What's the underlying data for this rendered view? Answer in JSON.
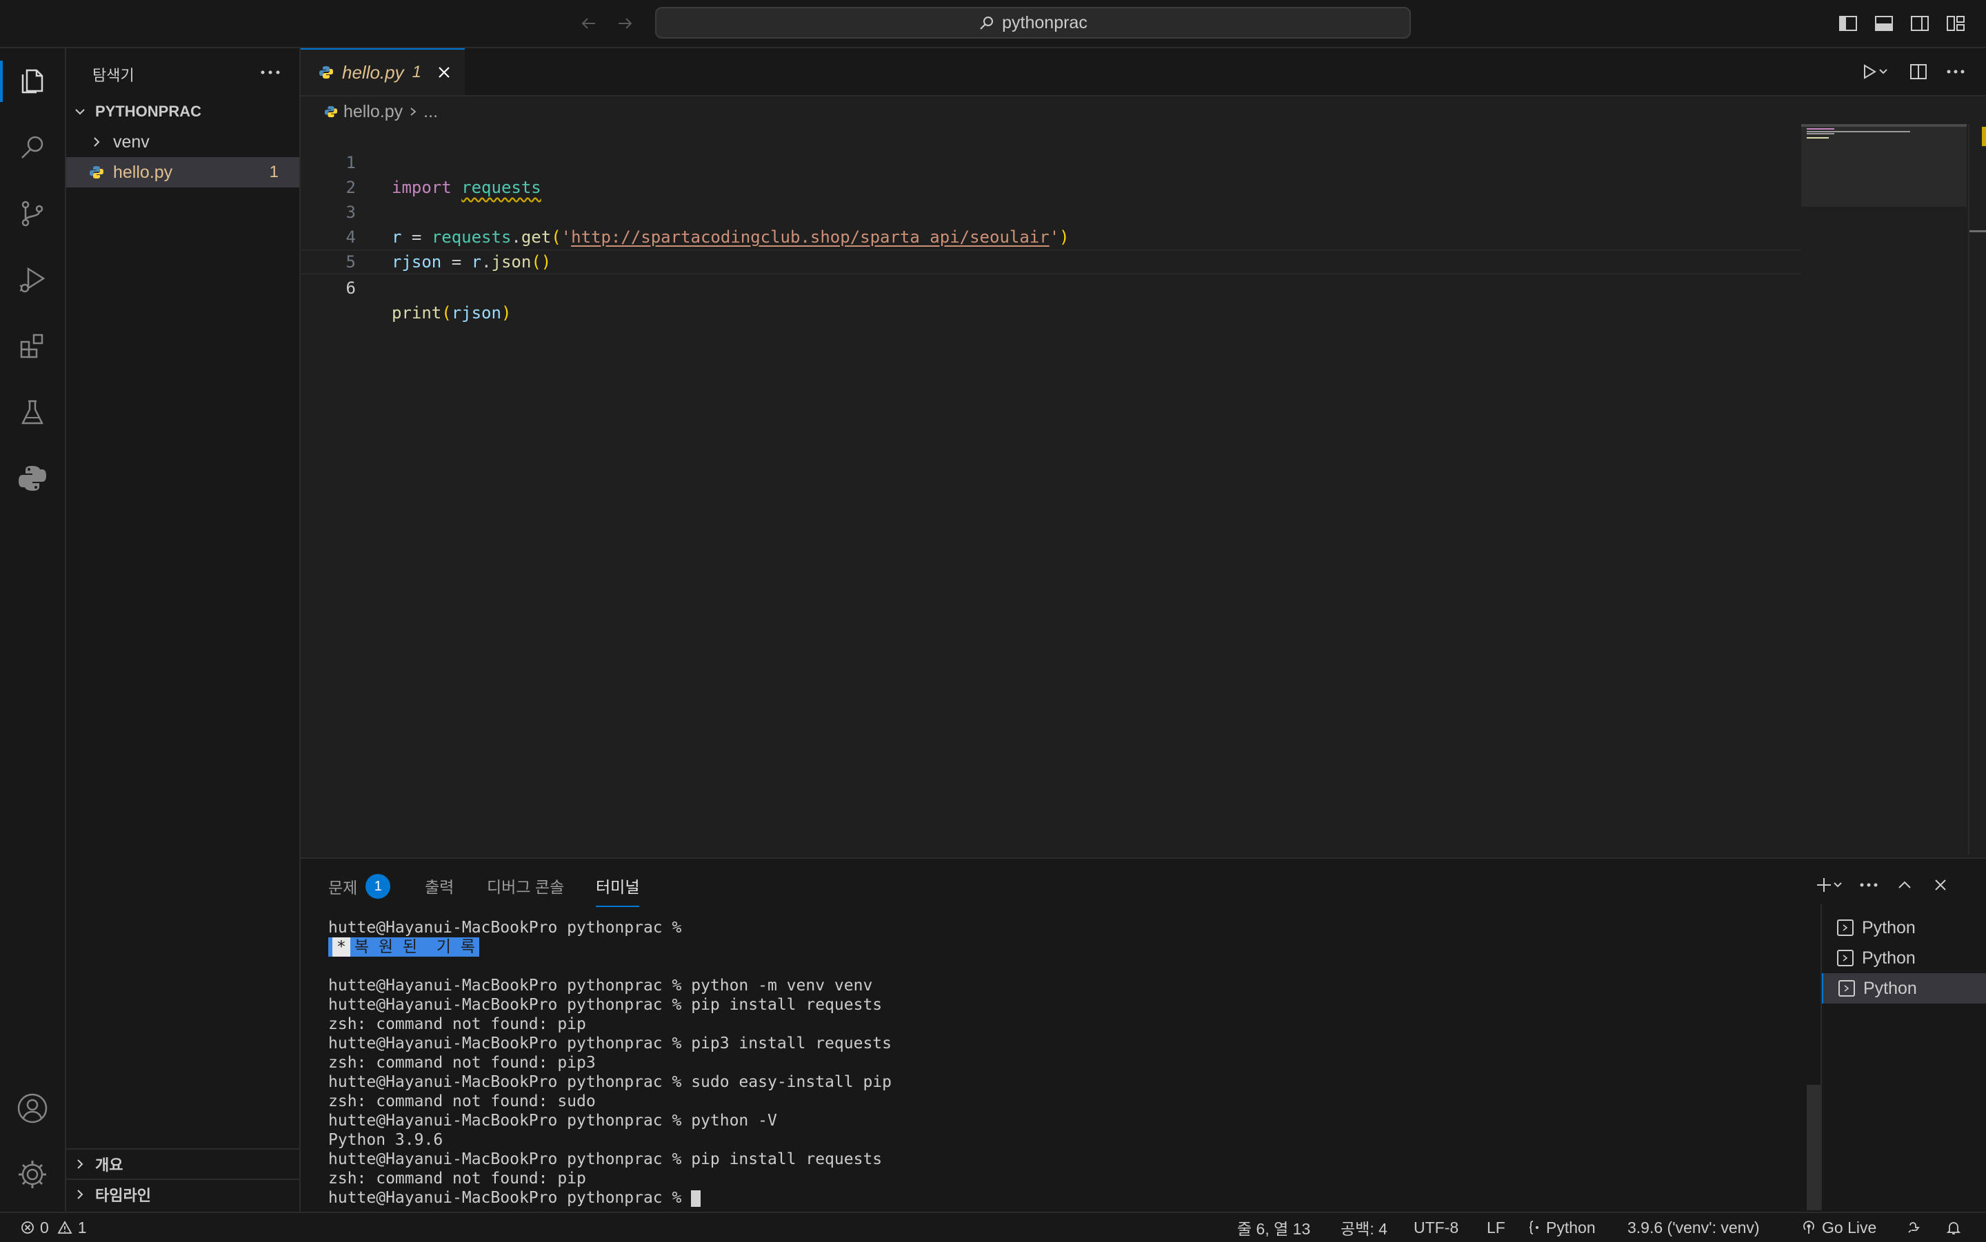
{
  "titlebar": {
    "search_text": "pythonprac",
    "back_icon": "arrow-left-icon",
    "forward_icon": "arrow-right-icon"
  },
  "activity_bar": {
    "items": [
      "explorer",
      "search",
      "source-control",
      "run-and-debug",
      "extensions",
      "testing",
      "python"
    ],
    "bottom": [
      "accounts",
      "manage"
    ]
  },
  "sidebar": {
    "title": "탐색기",
    "folder": "PYTHONPRAC",
    "items": [
      {
        "label": "venv",
        "type": "folder"
      },
      {
        "label": "hello.py",
        "type": "file",
        "badge": "1"
      }
    ],
    "bottom_sections": [
      "개요",
      "타임라인"
    ]
  },
  "editor": {
    "tab": {
      "label": "hello.py",
      "badge": "1"
    },
    "breadcrumb": {
      "file": "hello.py",
      "rest": "..."
    },
    "lines": [
      {
        "n": "1"
      },
      {
        "n": "2"
      },
      {
        "n": "3"
      },
      {
        "n": "4"
      },
      {
        "n": "5"
      },
      {
        "n": "6"
      }
    ],
    "code": {
      "l1_kw": "import",
      "l1_mod": "requests",
      "l3_var": "r",
      "l3_eq": " = ",
      "l3_mod": "requests",
      "l3_dot": ".",
      "l3_fn": "get",
      "l3_open": "(",
      "l3_q1": "'",
      "l3_url": "http://spartacodingclub.shop/sparta_api/seoulair",
      "l3_q2": "'",
      "l3_close": ")",
      "l4_var": "rjson",
      "l4_eq": " = ",
      "l4_r": "r",
      "l4_dot": ".",
      "l4_fn": "json",
      "l4_parens": "()",
      "l6_fn": "print",
      "l6_open": "(",
      "l6_arg": "rjson",
      "l6_close": ")"
    }
  },
  "panel": {
    "tabs": [
      {
        "label": "문제",
        "badge": "1"
      },
      {
        "label": "출력"
      },
      {
        "label": "디버그 콘솔"
      },
      {
        "label": "터미널",
        "active": true
      }
    ],
    "terminal_lines": [
      "hutte@Hayanui-MacBookPro pythonprac % ",
      "",
      "",
      "hutte@Hayanui-MacBookPro pythonprac % python -m venv venv",
      "hutte@Hayanui-MacBookPro pythonprac % pip install requests",
      "zsh: command not found: pip",
      "hutte@Hayanui-MacBookPro pythonprac % pip3 install requests",
      "zsh: command not found: pip3",
      "hutte@Hayanui-MacBookPro pythonprac % sudo easy-install pip",
      "zsh: command not found: sudo",
      "hutte@Hayanui-MacBookPro pythonprac % python -V",
      "Python 3.9.6",
      "hutte@Hayanui-MacBookPro pythonprac % pip install requests",
      "zsh: command not found: pip",
      "hutte@Hayanui-MacBookPro pythonprac % "
    ],
    "restored_star": "*",
    "restored_label": "복 원 된  기 록",
    "terminals": [
      "Python",
      "Python",
      "Python"
    ]
  },
  "statusbar": {
    "errors": "0",
    "warnings": "1",
    "position": "줄 6, 열 13",
    "spaces": "공백: 4",
    "encoding": "UTF-8",
    "eol": "LF",
    "language": "Python",
    "interpreter": "3.9.6 ('venv': venv)",
    "golive": "Go Live"
  }
}
